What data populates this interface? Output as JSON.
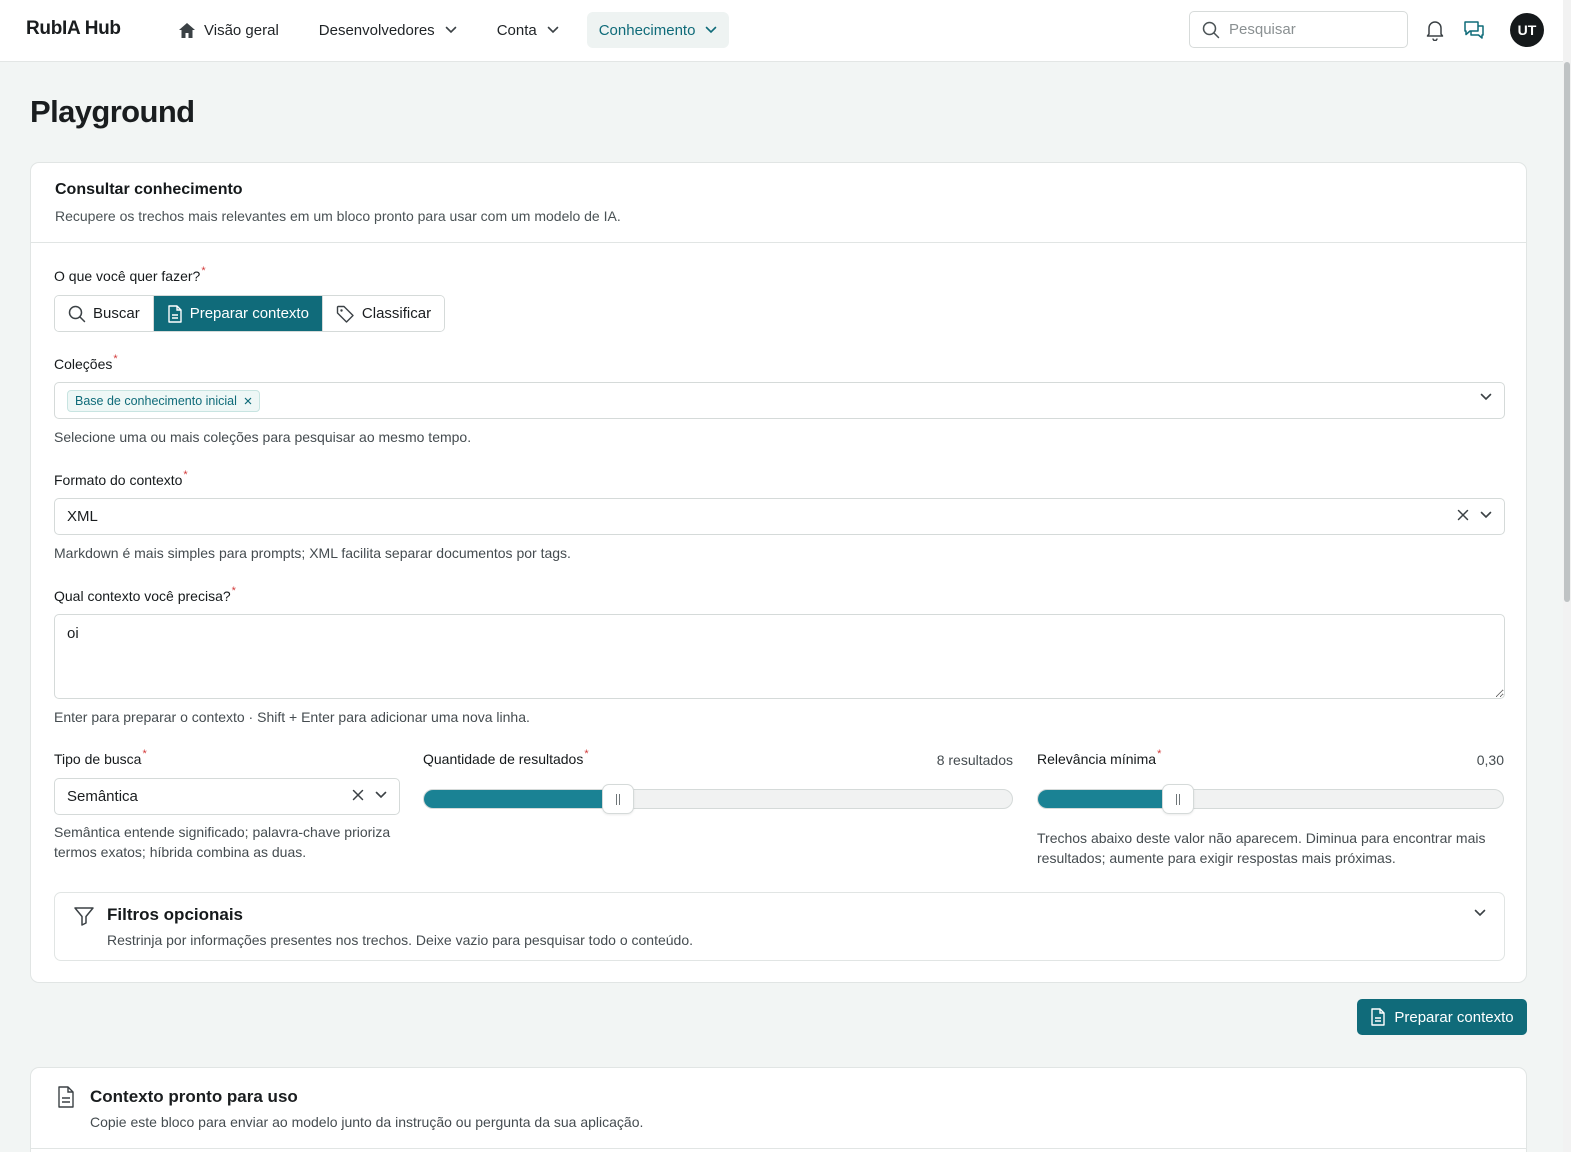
{
  "brand": "RubIA Hub",
  "nav": [
    {
      "label": "Visão geral",
      "icon": "home-icon"
    },
    {
      "label": "Desenvolvedores",
      "icon": "chevron-down-icon"
    },
    {
      "label": "Conta",
      "icon": "chevron-down-icon"
    },
    {
      "label": "Conhecimento",
      "icon": "chevron-down-icon",
      "active": true
    }
  ],
  "search": {
    "placeholder": "Pesquisar"
  },
  "user": {
    "initials": "UT"
  },
  "page": {
    "title": "Playground"
  },
  "card": {
    "title": "Consultar conhecimento",
    "subtitle": "Recupere os trechos mais relevantes em um bloco pronto para usar com um modelo de IA."
  },
  "mode": {
    "label": "O que você quer fazer?",
    "options": [
      "Buscar",
      "Preparar contexto",
      "Classificar"
    ],
    "selected": "Preparar contexto"
  },
  "collections": {
    "label": "Coleções",
    "tags": [
      "Base de conhecimento inicial"
    ],
    "help": "Selecione uma ou mais coleções para pesquisar ao mesmo tempo."
  },
  "format": {
    "label": "Formato do contexto",
    "value": "XML",
    "help": "Markdown é mais simples para prompts; XML facilita separar documentos por tags."
  },
  "query": {
    "label": "Qual contexto você precisa?",
    "value": "oi",
    "help": "Enter para preparar o contexto · Shift + Enter para adicionar uma nova linha."
  },
  "search_type": {
    "label": "Tipo de busca",
    "value": "Semântica",
    "help": "Semântica entende significado; palavra-chave prioriza termos exatos; híbrida combina as duas."
  },
  "results_count": {
    "label": "Quantidade de resultados",
    "value_text": "8 resultados",
    "fraction": 0.33
  },
  "min_relevance": {
    "label": "Relevância mínima",
    "value_text": "0,30",
    "fraction": 0.3,
    "help": "Trechos abaixo deste valor não aparecem. Diminua para encontrar mais resultados; aumente para exigir respostas mais próximas."
  },
  "filters": {
    "title": "Filtros opcionais",
    "subtitle": "Restrinja por informações presentes nos trechos. Deixe vazio para pesquisar todo o conteúdo."
  },
  "primary_button": {
    "label": "Preparar contexto"
  },
  "result_card": {
    "title": "Contexto pronto para uso",
    "subtitle": "Copie este bloco para enviar ao modelo junto da instrução ou pergunta da sua aplicação."
  },
  "colors": {
    "accent": "#106b7a",
    "slider_fill": "#1a8294",
    "required": "#d23b3b"
  }
}
